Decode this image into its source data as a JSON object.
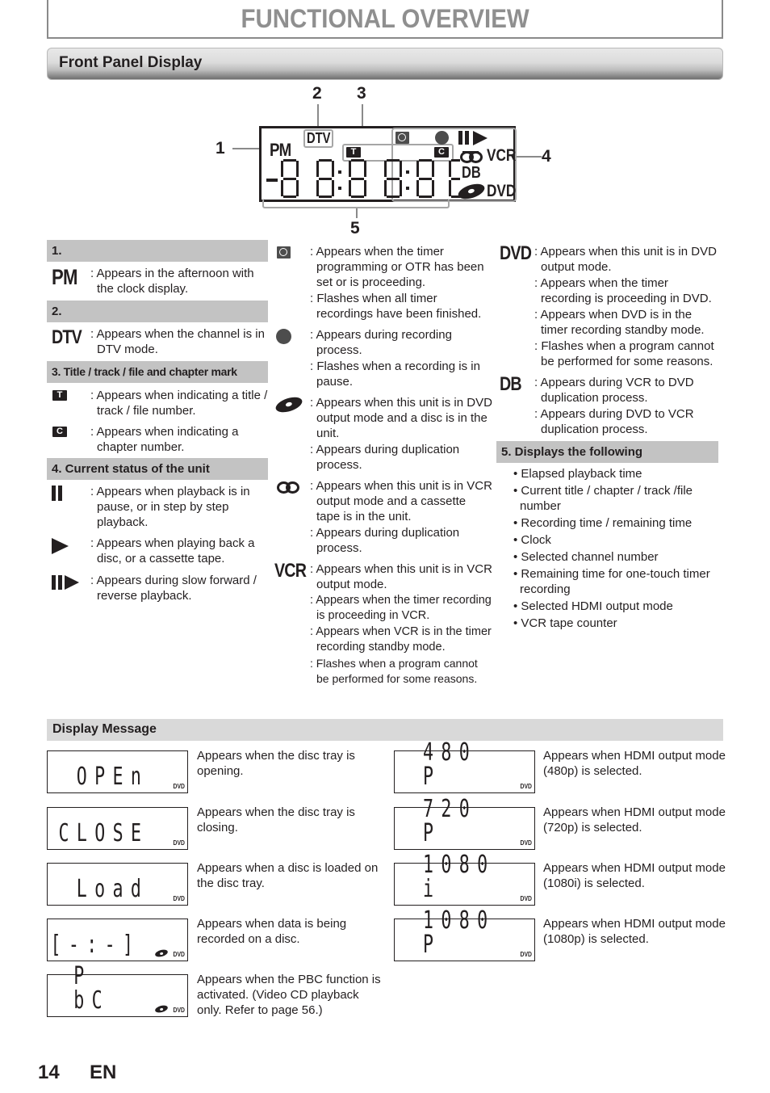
{
  "page": {
    "title": "FUNCTIONAL OVERVIEW",
    "section_title": "Front Panel Display",
    "page_number": "14",
    "language": "EN"
  },
  "diagram": {
    "callouts": [
      "1",
      "2",
      "3",
      "4",
      "5"
    ],
    "lcd": {
      "pm_label": "PM",
      "dtv_label": "DTV",
      "title_mark": "T",
      "chapter_mark": "C",
      "vcr_label": "VCR",
      "db_label": "DB",
      "dvd_label": "DVD",
      "digits": "-8 8:8 8:8 8",
      "icons": [
        "clock-icon",
        "record-dot-icon",
        "pause-icon",
        "play-icon",
        "tape-icon",
        "disc-icon"
      ]
    }
  },
  "col1": {
    "h1": "1.",
    "pm": {
      "icon_label": "PM",
      "lines": [
        ": Appears in the afternoon with the clock display."
      ]
    },
    "h2": "2.",
    "dtv": {
      "icon_label": "DTV",
      "lines": [
        ": Appears when the channel is in DTV mode."
      ]
    },
    "h3": "3. Title / track / file and chapter mark",
    "t": {
      "icon_label": "T",
      "lines": [
        ": Appears when indicating a title / track / file number."
      ]
    },
    "c": {
      "icon_label": "C",
      "lines": [
        ": Appears when indicating a chapter number."
      ]
    },
    "h4": "4. Current status of the unit",
    "pause": {
      "icon": "pause-icon",
      "lines": [
        ": Appears when playback is in pause, or in step by step playback."
      ]
    },
    "play": {
      "icon": "play-icon",
      "lines": [
        ": Appears when playing back a disc, or a cassette tape."
      ]
    },
    "slow": {
      "icon": "slow-play-icon",
      "lines": [
        ": Appears during slow forward / reverse playback."
      ]
    }
  },
  "col2": {
    "timer": {
      "icon": "clock-icon",
      "lines": [
        ": Appears when the timer programming or OTR has been set or is proceeding.",
        ": Flashes when all timer recordings have been finished."
      ]
    },
    "rec": {
      "icon": "record-dot-icon",
      "lines": [
        ": Appears during recording process.",
        ": Flashes when a recording is in pause."
      ]
    },
    "disc": {
      "icon": "disc-icon",
      "lines": [
        ": Appears when this unit is in DVD output mode and a disc is in the unit.",
        ": Appears during duplication process."
      ]
    },
    "tape": {
      "icon": "tape-icon",
      "lines": [
        ": Appears when this unit is in VCR output mode and a cassette tape is in the unit.",
        ": Appears during duplication process."
      ]
    },
    "vcr": {
      "icon_label": "VCR",
      "lines": [
        ": Appears when this unit is in VCR output mode.",
        ": Appears when the timer recording is proceeding in VCR.",
        ": Appears when VCR is in the timer recording standby mode.",
        ": Flashes when a program cannot be performed for some reasons."
      ]
    }
  },
  "col3": {
    "dvd": {
      "icon_label": "DVD",
      "lines": [
        ": Appears when this unit is in DVD output mode.",
        ": Appears when the timer recording is proceeding in DVD.",
        ": Appears when DVD is in the timer recording standby mode.",
        ": Flashes when a program cannot be performed for some reasons."
      ]
    },
    "db": {
      "icon_label": "DB",
      "lines": [
        ": Appears during VCR to DVD duplication process.",
        ": Appears during DVD to VCR duplication process."
      ]
    },
    "h5": "5. Displays the following",
    "bullets": [
      "• Elapsed playback time",
      "• Current title / chapter / track /file number",
      "• Recording time / remaining time",
      "• Clock",
      "• Selected channel number",
      "• Remaining time for one-touch timer recording",
      "• Selected HDMI output mode",
      "• VCR tape counter"
    ]
  },
  "display_message": {
    "title": "Display Message",
    "indicator": "DVD",
    "left": [
      {
        "display": "OPEn",
        "disc": false,
        "desc": "Appears when the disc tray is opening."
      },
      {
        "display": "CLOSE",
        "disc": false,
        "desc": "Appears when the disc tray is closing."
      },
      {
        "display": "Load",
        "disc": false,
        "desc": "Appears when a disc is loaded on the disc tray."
      },
      {
        "display": "[-:-]",
        "disc": true,
        "desc": "Appears when data is being recorded on a disc."
      },
      {
        "display": "P bC",
        "disc": true,
        "desc": "Appears when the PBC function is activated. (Video CD playback only. Refer to page 56.)"
      }
    ],
    "right": [
      {
        "display": "480 P",
        "disc": false,
        "desc": "Appears when HDMI output mode (480p) is selected."
      },
      {
        "display": "720 P",
        "disc": false,
        "desc": "Appears when HDMI output mode (720p) is selected."
      },
      {
        "display": "1080 i",
        "disc": false,
        "desc": "Appears when HDMI output mode (1080i) is selected."
      },
      {
        "display": "1080 P",
        "disc": false,
        "desc": "Appears when HDMI output mode (1080p) is selected."
      }
    ]
  }
}
